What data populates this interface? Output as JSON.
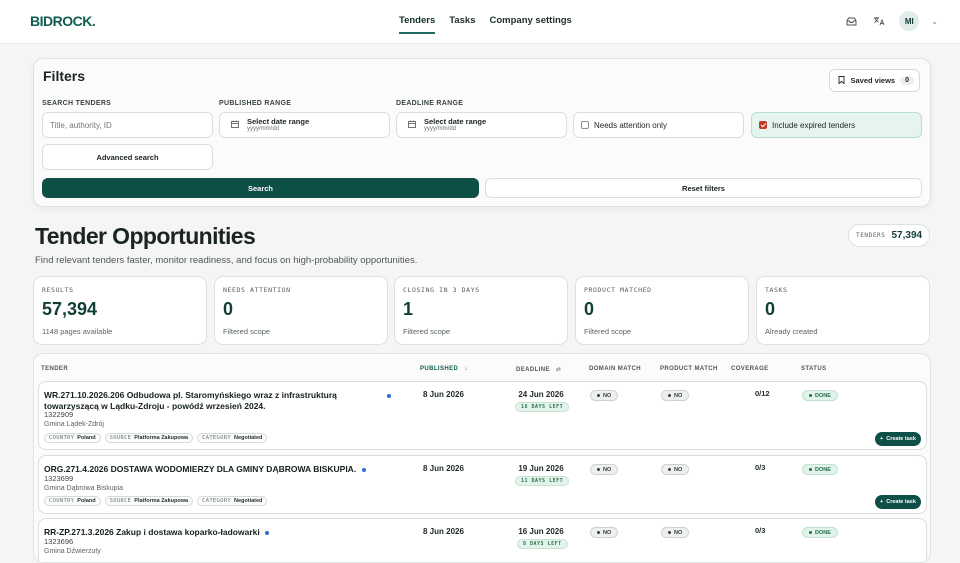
{
  "app": {
    "logo": "BIDROCK."
  },
  "nav": {
    "items": [
      "Tenders",
      "Tasks",
      "Company settings"
    ],
    "active": "Tenders"
  },
  "user": {
    "initials": "MI"
  },
  "icons": {
    "inbox": "inbox-icon",
    "translate": "translate-icon",
    "chevron": "chevron-down-icon",
    "calendar": "calendar-icon",
    "bookmark": "bookmark-icon"
  },
  "filters": {
    "title": "Filters",
    "saved_views_label": "Saved views",
    "saved_views_count": "0",
    "search_label": "SEARCH TENDERS",
    "search_placeholder": "Title, authority, ID",
    "published_label": "PUBLISHED RANGE",
    "deadline_label": "DEADLINE RANGE",
    "date_placeholder": "Select date range",
    "date_format": "yyyy/mm/dd",
    "needs_attention_label": "Needs attention only",
    "needs_attention_checked": false,
    "include_expired_label": "Include expired tenders",
    "include_expired_checked": true,
    "advanced_search": "Advanced search",
    "search_button": "Search",
    "reset_button": "Reset filters"
  },
  "header": {
    "title": "Tender Opportunities",
    "subtitle": "Find relevant tenders faster, monitor readiness, and focus on high-probability opportunities.",
    "tenders_label": "TENDERS",
    "tenders_count": "57,394"
  },
  "stats": [
    {
      "label": "RESULTS",
      "value": "57,394",
      "sub": "1148 pages available"
    },
    {
      "label": "NEEDS ATTENTION",
      "value": "0",
      "sub": "Filtered scope"
    },
    {
      "label": "CLOSING IN 3 DAYS",
      "value": "1",
      "sub": "Filtered scope"
    },
    {
      "label": "PRODUCT MATCHED",
      "value": "0",
      "sub": "Filtered scope"
    },
    {
      "label": "TASKS",
      "value": "0",
      "sub": "Already created"
    }
  ],
  "table": {
    "columns": {
      "tender": "TENDER",
      "published": "PUBLISHED",
      "deadline": "DEADLINE",
      "domain_match": "DOMAIN MATCH",
      "product_match": "PRODUCT MATCH",
      "coverage": "COVERAGE",
      "status": "STATUS"
    },
    "tag_keys": {
      "country": "COUNTRY",
      "source": "SOURCE",
      "category": "CATEGORY"
    },
    "create_task_label": "Create task",
    "rows": [
      {
        "title": "WR.271.10.2026.206 Odbudowa pl. Staromyńskiego wraz z infrastrukturą towarzyszącą w Lądku-Zdroju - powódź wrzesień 2024.",
        "id": "1322909",
        "authority": "Gmina Lądek-Zdrój",
        "country": "Poland",
        "source": "Platforma Zakupowa",
        "category": "Negotiated",
        "published": "8 Jun 2026",
        "deadline": "24 Jun 2026",
        "days_left": "16 DAYS LEFT",
        "domain_match": "NO",
        "product_match": "NO",
        "coverage": "0/12",
        "status": "DONE"
      },
      {
        "title": "ORG.271.4.2026 DOSTAWA WODOMIERZY DLA GMINY DĄBROWA BISKUPIA.",
        "id": "1323699",
        "authority": "Gmina Dąbrowa Biskupia",
        "country": "Poland",
        "source": "Platforma Zakupowa",
        "category": "Negotiated",
        "published": "8 Jun 2026",
        "deadline": "19 Jun 2026",
        "days_left": "11 DAYS LEFT",
        "domain_match": "NO",
        "product_match": "NO",
        "coverage": "0/3",
        "status": "DONE"
      },
      {
        "title": "RR-ZP.271.3.2026 Zakup i dostawa koparko-ładowarki",
        "id": "1323696",
        "authority": "Gmina Dźwierzuty",
        "published": "8 Jun 2026",
        "deadline": "16 Jun 2026",
        "days_left": "8 DAYS LEFT",
        "domain_match": "NO",
        "product_match": "NO",
        "coverage": "0/3",
        "status": "DONE"
      }
    ]
  }
}
